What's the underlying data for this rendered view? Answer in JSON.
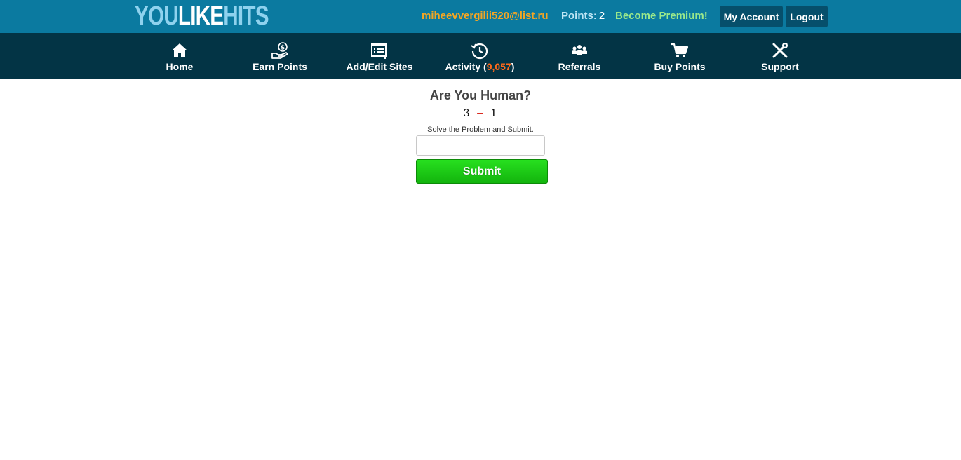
{
  "header": {
    "logo": {
      "part1": "YOU",
      "part2": "LIKE",
      "part3": "HITS"
    },
    "email": "miheevvergilii520@list.ru",
    "points_label": "Points:",
    "points_value": "2",
    "premium": "Become Premium!",
    "my_account": "My Account",
    "logout": "Logout"
  },
  "nav": {
    "home": "Home",
    "earn": "Earn Points",
    "sites": "Add/Edit Sites",
    "activity": "Activity",
    "activity_count": "9,057",
    "referrals": "Referrals",
    "buy": "Buy Points",
    "support": "Support"
  },
  "captcha": {
    "title": "Are You Human?",
    "operand1": "3",
    "operator": "−",
    "operand2": "1",
    "hint": "Solve the Problem and Submit.",
    "answer_value": "",
    "submit": "Submit"
  },
  "colors": {
    "topbar": "#0b7aa0",
    "navbar": "#033445",
    "email": "#f5a623",
    "premium": "#9ae88b",
    "submit": "#1ccb14"
  }
}
